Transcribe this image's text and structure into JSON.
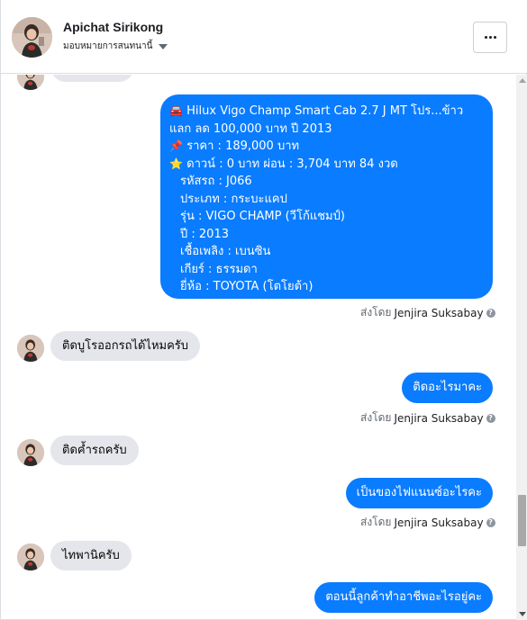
{
  "header": {
    "name": "Apichat Sirikong",
    "subtitle": "มอบหมายการสนทนานี้",
    "more_label": "..."
  },
  "thread": {
    "car_listing": {
      "lines": [
        {
          "emoji": "🚘",
          "text": "Hilux Vigo Champ Smart Cab 2.7 J MT โปร...ข้าว"
        },
        {
          "emoji": "",
          "text": "แลก ลด 100,000 บาท ปี 2013"
        },
        {
          "emoji": "📌",
          "text": "ราคา : 189,000 บาท"
        },
        {
          "emoji": "⭐",
          "text": "ดาวน์ : 0 บาท ผ่อน : 3,704 บาท 84 งวด"
        },
        {
          "emoji": "",
          "text": "รหัสรถ : J066"
        },
        {
          "emoji": "",
          "text": "ประเภท : กระบะแคป"
        },
        {
          "emoji": "",
          "text": "รุ่น : VIGO CHAMP (วีโก้แชมป์)"
        },
        {
          "emoji": "",
          "text": "ปี : 2013"
        },
        {
          "emoji": "",
          "text": "เชื้อเพลิง : เบนซิน"
        },
        {
          "emoji": "",
          "text": "เกียร์ : ธรรมดา"
        },
        {
          "emoji": "",
          "text": "ยี่ห้อ : TOYOTA (โตโยต้า)"
        }
      ]
    },
    "sent_by_prefix": "ส่งโดย",
    "sent_by_name": "Jenjira Suksabay",
    "msg_in_1": "ติดบูโรออกรถได้ไหมครับ",
    "msg_out_1": "ติดอะไรมาคะ",
    "msg_in_2": "ติดค้ำรถครับ",
    "msg_out_2": "เป็นของไฟแนนซ์อะไรคะ",
    "msg_in_3": "ไทพานิครับ",
    "msg_out_3": "ตอนนี้ลูกค้าทำอาชีพอะไรอยู่คะ"
  },
  "colors": {
    "outgoing_bubble": "#0a7cff",
    "incoming_bubble": "#e4e6eb"
  }
}
